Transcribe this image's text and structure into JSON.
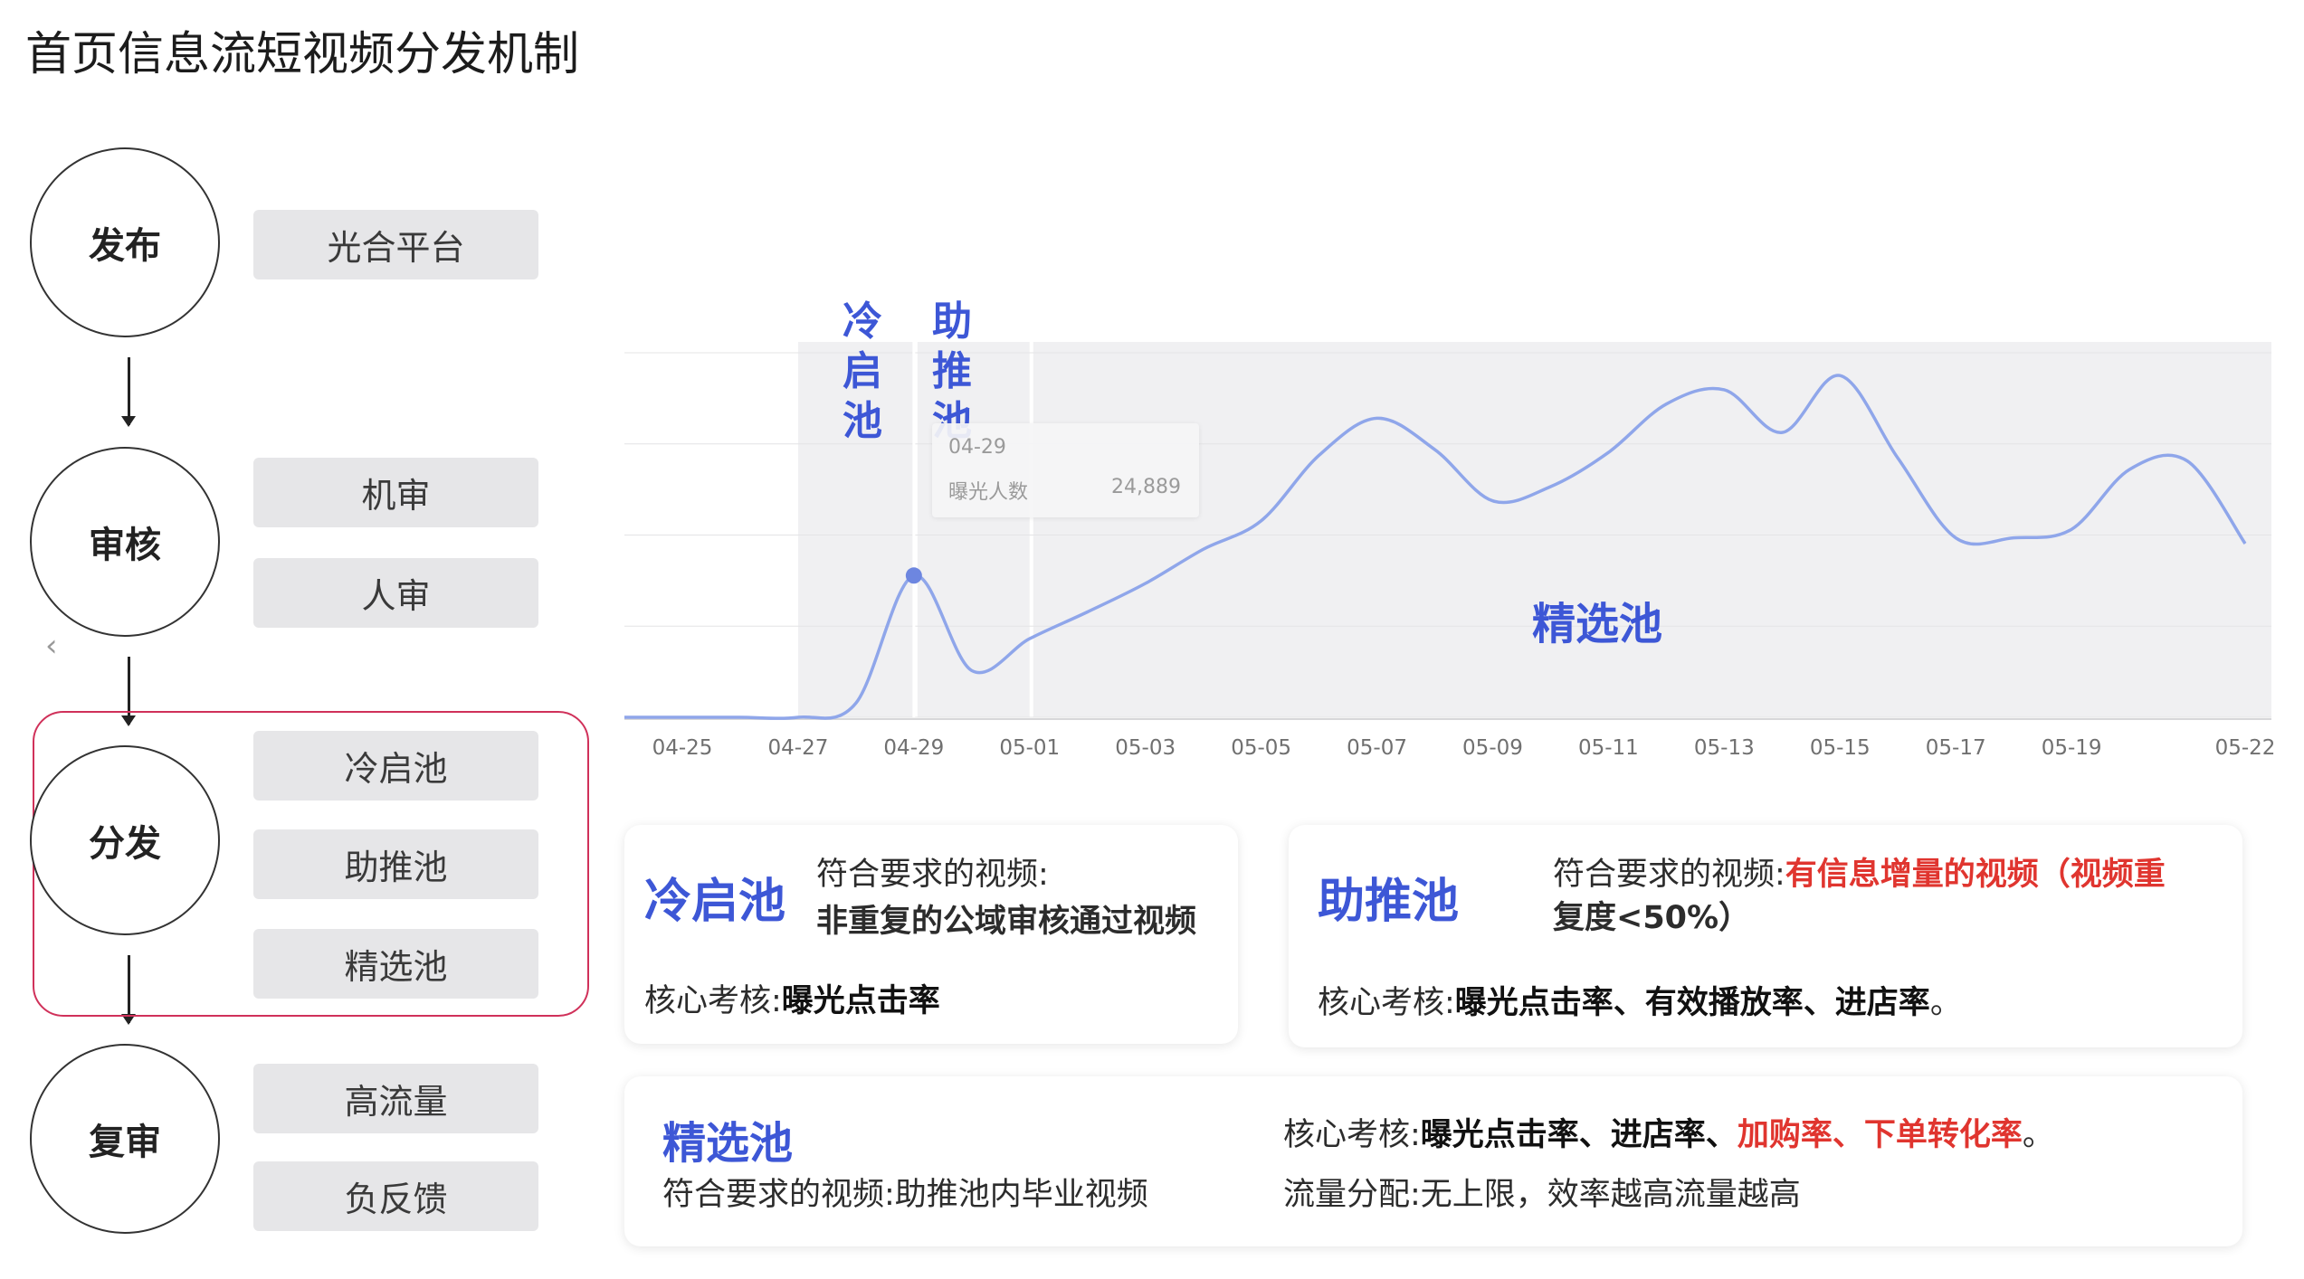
{
  "page_title": "首页信息流短视频分发机制",
  "flow": {
    "stages": [
      {
        "label": "发布",
        "items": [
          "光合平台"
        ]
      },
      {
        "label": "审核",
        "items": [
          "机审",
          "人审"
        ]
      },
      {
        "label": "分发",
        "items": [
          "冷启池",
          "助推池",
          "精选池"
        ]
      },
      {
        "label": "复审",
        "items": [
          "高流量",
          "负反馈"
        ]
      }
    ],
    "chevron": "‹"
  },
  "chart_labels": {
    "cold": "冷启池",
    "boost": "助推池",
    "select": "精选池"
  },
  "tooltip": {
    "date": "04-29",
    "metric": "曝光人数",
    "value": "24,889"
  },
  "chart_data": {
    "type": "line",
    "title": "",
    "xlabel": "",
    "ylabel": "",
    "x_ticks": [
      "04-25",
      "04-27",
      "04-29",
      "05-01",
      "05-03",
      "05-05",
      "05-07",
      "05-09",
      "05-11",
      "05-13",
      "05-15",
      "05-17",
      "05-19",
      "05-22"
    ],
    "series": [
      {
        "color": "#8fa6ea",
        "points": [
          [
            "04-25",
            0
          ],
          [
            "04-26",
            0
          ],
          [
            "04-27",
            0
          ],
          [
            "04-28",
            2500
          ],
          [
            "04-29",
            24889
          ],
          [
            "04-30",
            8200
          ],
          [
            "05-01",
            13800
          ],
          [
            "05-02",
            18500
          ],
          [
            "05-03",
            23500
          ],
          [
            "05-04",
            29500
          ],
          [
            "05-05",
            34500
          ],
          [
            "05-06",
            46000
          ],
          [
            "05-07",
            52500
          ],
          [
            "05-08",
            47000
          ],
          [
            "05-09",
            38000
          ],
          [
            "05-10",
            40500
          ],
          [
            "05-11",
            46500
          ],
          [
            "05-12",
            55000
          ],
          [
            "05-13",
            57500
          ],
          [
            "05-14",
            50000
          ],
          [
            "05-15",
            60000
          ],
          [
            "05-16",
            45500
          ],
          [
            "05-17",
            31500
          ],
          [
            "05-18",
            31500
          ],
          [
            "05-19",
            33000
          ],
          [
            "05-20",
            43500
          ],
          [
            "05-21",
            45000
          ],
          [
            "05-22",
            30500
          ]
        ]
      }
    ],
    "ylim": [
      0,
      64000
    ],
    "grid": true,
    "highlight_point": [
      "04-29",
      24889
    ],
    "shaded_ranges": [
      [
        "04-27",
        "04-29"
      ],
      [
        "04-29",
        "05-01"
      ],
      [
        "05-01",
        "05-22"
      ]
    ]
  },
  "cards": {
    "cold": {
      "title": "冷启池",
      "req_label": "符合要求的视频:",
      "req_value": "非重复的公域审核通过视频",
      "kpi_label": "核心考核:",
      "kpi_value": "曝光点击率"
    },
    "boost": {
      "title": "助推池",
      "req_label": "符合要求的视频:",
      "req_value_line1": "有信息增量的视频（视频重",
      "req_value_line2": "复度<50%）",
      "kpi_label": "核心考核:",
      "kpi_value": "曝光点击率、有效播放率、进店率",
      "kpi_end": "。"
    },
    "select": {
      "title": "精选池",
      "req_label": "符合要求的视频:",
      "req_value": "助推池内毕业视频",
      "kpi_label": "核心考核:",
      "kpi_value_black": "曝光点击率、进店率、",
      "kpi_value_red": "加购率、下单转化率",
      "kpi_end": "。",
      "traffic_label": "流量分配:",
      "traffic_value": "无上限，效率越高流量越高"
    }
  },
  "colors": {
    "accent_blue": "#3d57d6",
    "line": "#8fa6ea",
    "red": "#e0352f",
    "border_pink": "#d0315a"
  }
}
